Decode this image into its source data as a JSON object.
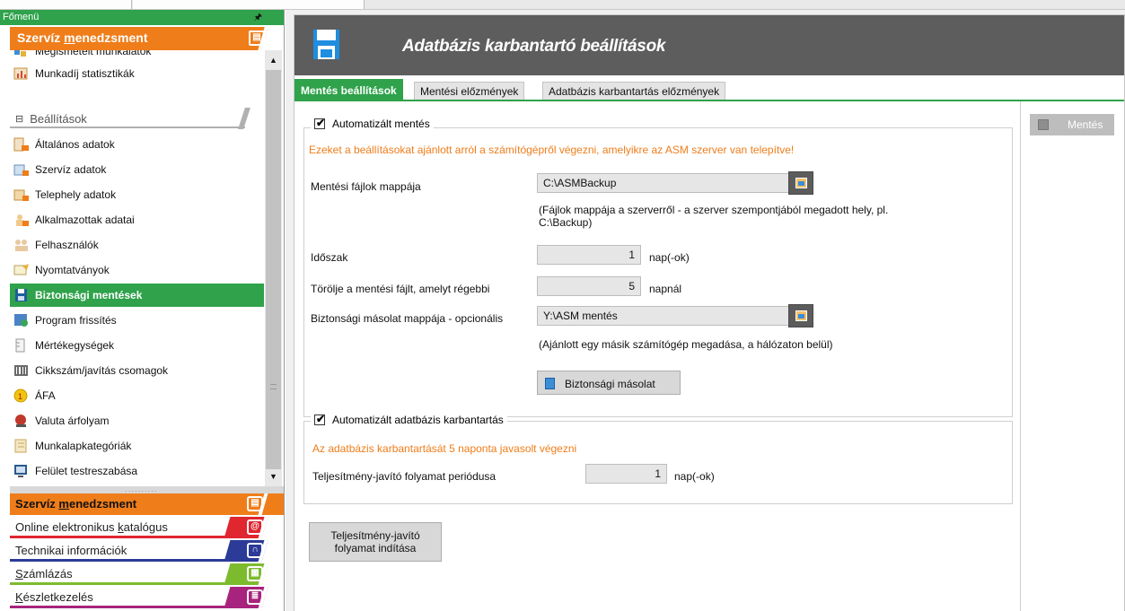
{
  "main_menu": {
    "title": "Főmenü",
    "pin_glyph": "🖈",
    "module_banner": {
      "prefix": "Szervíz ",
      "underlined": "m",
      "suffix": "enedzsment"
    },
    "items_partial": "Megismételt munkalatok",
    "items": [
      {
        "label": "Munkadíj statisztikák",
        "icon": "chart-icon"
      },
      {
        "label": "Általános adatok",
        "icon": "house-icon"
      },
      {
        "label": "Szervíz adatok",
        "icon": "service-icon"
      },
      {
        "label": "Telephely adatok",
        "icon": "site-icon"
      },
      {
        "label": "Alkalmazottak adatai",
        "icon": "employee-icon"
      },
      {
        "label": "Felhasználók",
        "icon": "users-icon"
      },
      {
        "label": "Nyomtatványok",
        "icon": "print-forms-icon"
      },
      {
        "label": "Biztonsági mentések",
        "icon": "floppy-icon"
      },
      {
        "label": "Program frissítés",
        "icon": "update-icon"
      },
      {
        "label": "Mértékegységek",
        "icon": "ruler-icon"
      },
      {
        "label": "Cikkszám/javítás csomagok",
        "icon": "barcode-icon"
      },
      {
        "label": "ÁFA",
        "icon": "vat-icon"
      },
      {
        "label": "Valuta árfolyam",
        "icon": "currency-icon"
      },
      {
        "label": "Munkalapkategóriák",
        "icon": "category-icon"
      },
      {
        "label": "Felület testreszabása",
        "icon": "customize-icon"
      }
    ],
    "section_settings": "Beállítások",
    "section_symbol": "⊟",
    "active_item": "Biztonsági mentések",
    "bottom_modules": [
      {
        "label_prefix": "Szervíz ",
        "label_u": "m",
        "label_suffix": "enedzsment",
        "color": "#ef7d1a",
        "glyph": "▤"
      },
      {
        "label_prefix": "Online elektronikus ",
        "label_u": "k",
        "label_suffix": "atalógus",
        "color": "#e0262f",
        "glyph": "@"
      },
      {
        "label_prefix": "Technikai információk",
        "label_u": "",
        "label_suffix": "",
        "color": "#2b3b97",
        "glyph": "∩"
      },
      {
        "label_prefix": "",
        "label_u": "S",
        "label_suffix": "zámlázás",
        "color": "#7dbb2e",
        "glyph": "▦"
      },
      {
        "label_prefix": "",
        "label_u": "K",
        "label_suffix": "észletkezelés",
        "color": "#a8237d",
        "glyph": "≣"
      }
    ]
  },
  "page": {
    "title": "Adatbázis karbantartó beállítások",
    "tabs": [
      {
        "label": "Mentés beállítások",
        "active": true
      },
      {
        "label": "Mentési előzmények",
        "active": false
      },
      {
        "label": "Adatbázis karbantartás előzmények",
        "active": false
      }
    ],
    "auto_backup": {
      "checkbox_label": "Automatizált mentés",
      "checked": true,
      "warning": "Ezeket a beállításokat ajánlott arról a számítógépről végezni, amelyikre az ASM szerver van telepítve!",
      "folder_label": "Mentési fájlok mappája",
      "folder_value": "C:\\ASMBackup",
      "folder_hint_line1": "(Fájlok mappája a szerverről - a szerver szempontjából megadott hely, pl.",
      "folder_hint_line2": "C:\\Backup)",
      "period_label": "Időszak",
      "period_value": "1",
      "period_unit": "nap(-ok)",
      "delete_label": "Törölje a mentési fájlt, amelyt régebbi",
      "delete_value": "5",
      "delete_unit": "napnál",
      "copy_folder_label": "Biztonsági másolat mappája - opcionális",
      "copy_folder_value": "Y:\\ASM mentés",
      "copy_hint": "(Ajánlott egy másik számítógép megadása, a hálózaton belül)",
      "backup_button": "Biztonsági másolat"
    },
    "auto_maintenance": {
      "checkbox_label": "Automatizált adatbázis karbantartás",
      "checked": true,
      "warning": "Az adatbázis karbantartását 5 naponta javasolt végezni",
      "period_label": "Teljesítmény-javító folyamat periódusa",
      "period_value": "1",
      "period_unit": "nap(-ok)"
    },
    "start_button_line1": "Teljesítmény-javító",
    "start_button_line2": "folyamat indítása",
    "save_button": "Mentés"
  },
  "colors": {
    "accent_green": "#2fa24b",
    "warning_orange": "#ef7d1a",
    "title_bar": "#5d5d5d"
  }
}
